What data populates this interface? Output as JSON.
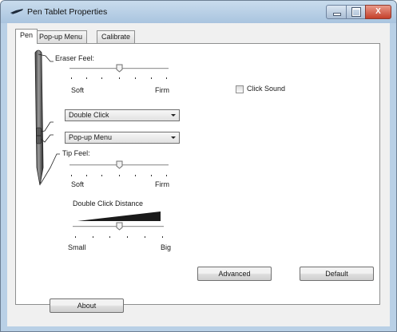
{
  "window": {
    "title": "Pen Tablet Properties",
    "close_glyph": "X"
  },
  "tabs": [
    {
      "label": "Pen",
      "selected": true
    },
    {
      "label": "Pop-up Menu",
      "selected": false
    },
    {
      "label": "Calibrate",
      "selected": false
    }
  ],
  "eraser_feel": {
    "label": "Eraser Feel:",
    "min_label": "Soft",
    "max_label": "Firm",
    "value_fraction": 0.5
  },
  "upper_button": {
    "value": "Double Click"
  },
  "lower_button": {
    "value": "Pop-up Menu"
  },
  "tip_feel": {
    "label": "Tip Feel:",
    "min_label": "Soft",
    "max_label": "Firm",
    "value_fraction": 0.5
  },
  "double_click_distance": {
    "label": "Double Click Distance",
    "min_label": "Small",
    "max_label": "Big",
    "value_fraction": 0.5
  },
  "click_sound": {
    "label": "Click Sound",
    "checked": false
  },
  "buttons": {
    "advanced": "Advanced",
    "default": "Default",
    "about": "About"
  },
  "icons": {
    "app": "pen-tablet-icon",
    "minimize": "minimize-icon",
    "maximize": "maximize-icon",
    "close": "close-icon"
  },
  "colors": {
    "titlebar": "#b9d0e6",
    "client": "#f0f0f0",
    "close_button": "#c4402a"
  }
}
